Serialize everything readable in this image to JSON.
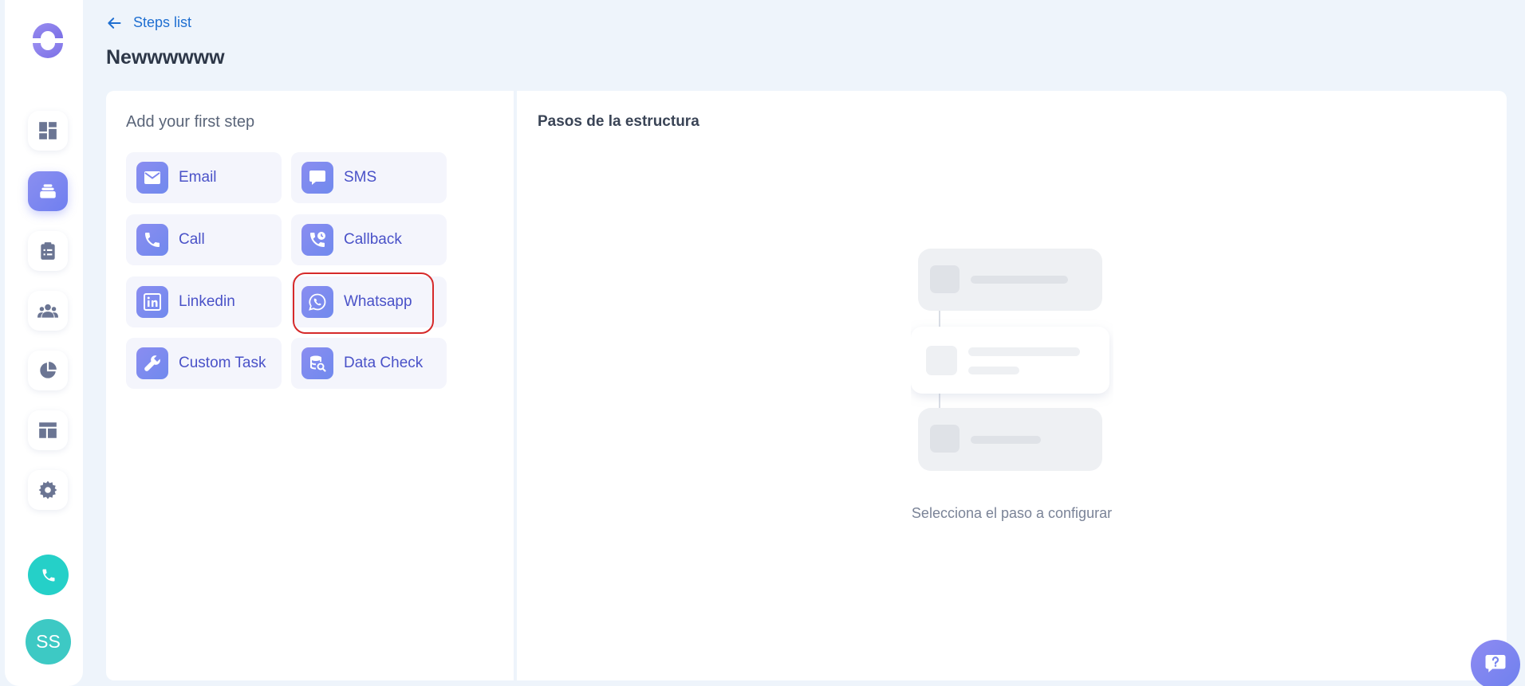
{
  "header": {
    "back_label": "Steps list",
    "title": "Newwwwww"
  },
  "sidebar": {
    "items": [
      {
        "icon": "dashboard-icon",
        "active": false
      },
      {
        "icon": "sequences-icon",
        "active": true
      },
      {
        "icon": "tasks-clipboard-icon",
        "active": false
      },
      {
        "icon": "contacts-group-icon",
        "active": false
      },
      {
        "icon": "reports-pie-icon",
        "active": false
      },
      {
        "icon": "templates-layout-icon",
        "active": false
      },
      {
        "icon": "settings-gear-icon",
        "active": false
      }
    ],
    "avatar_initials": "SS"
  },
  "left_panel": {
    "heading": "Add your first step",
    "steps": [
      {
        "label": "Email",
        "icon": "email-icon"
      },
      {
        "label": "SMS",
        "icon": "sms-icon"
      },
      {
        "label": "Call",
        "icon": "call-icon"
      },
      {
        "label": "Callback",
        "icon": "callback-icon"
      },
      {
        "label": "Linkedin",
        "icon": "linkedin-icon"
      },
      {
        "label": "Whatsapp",
        "icon": "whatsapp-icon"
      },
      {
        "label": "Custom Task",
        "icon": "wrench-icon"
      },
      {
        "label": "Data Check",
        "icon": "data-check-icon"
      }
    ]
  },
  "right_panel": {
    "heading": "Pasos de la estructura",
    "empty_text": "Selecciona el paso a configurar"
  },
  "colors": {
    "accent": "#6f7ff0",
    "link": "#1f6fd1",
    "highlight": "#d62a2a",
    "teal": "#25d0c8"
  }
}
